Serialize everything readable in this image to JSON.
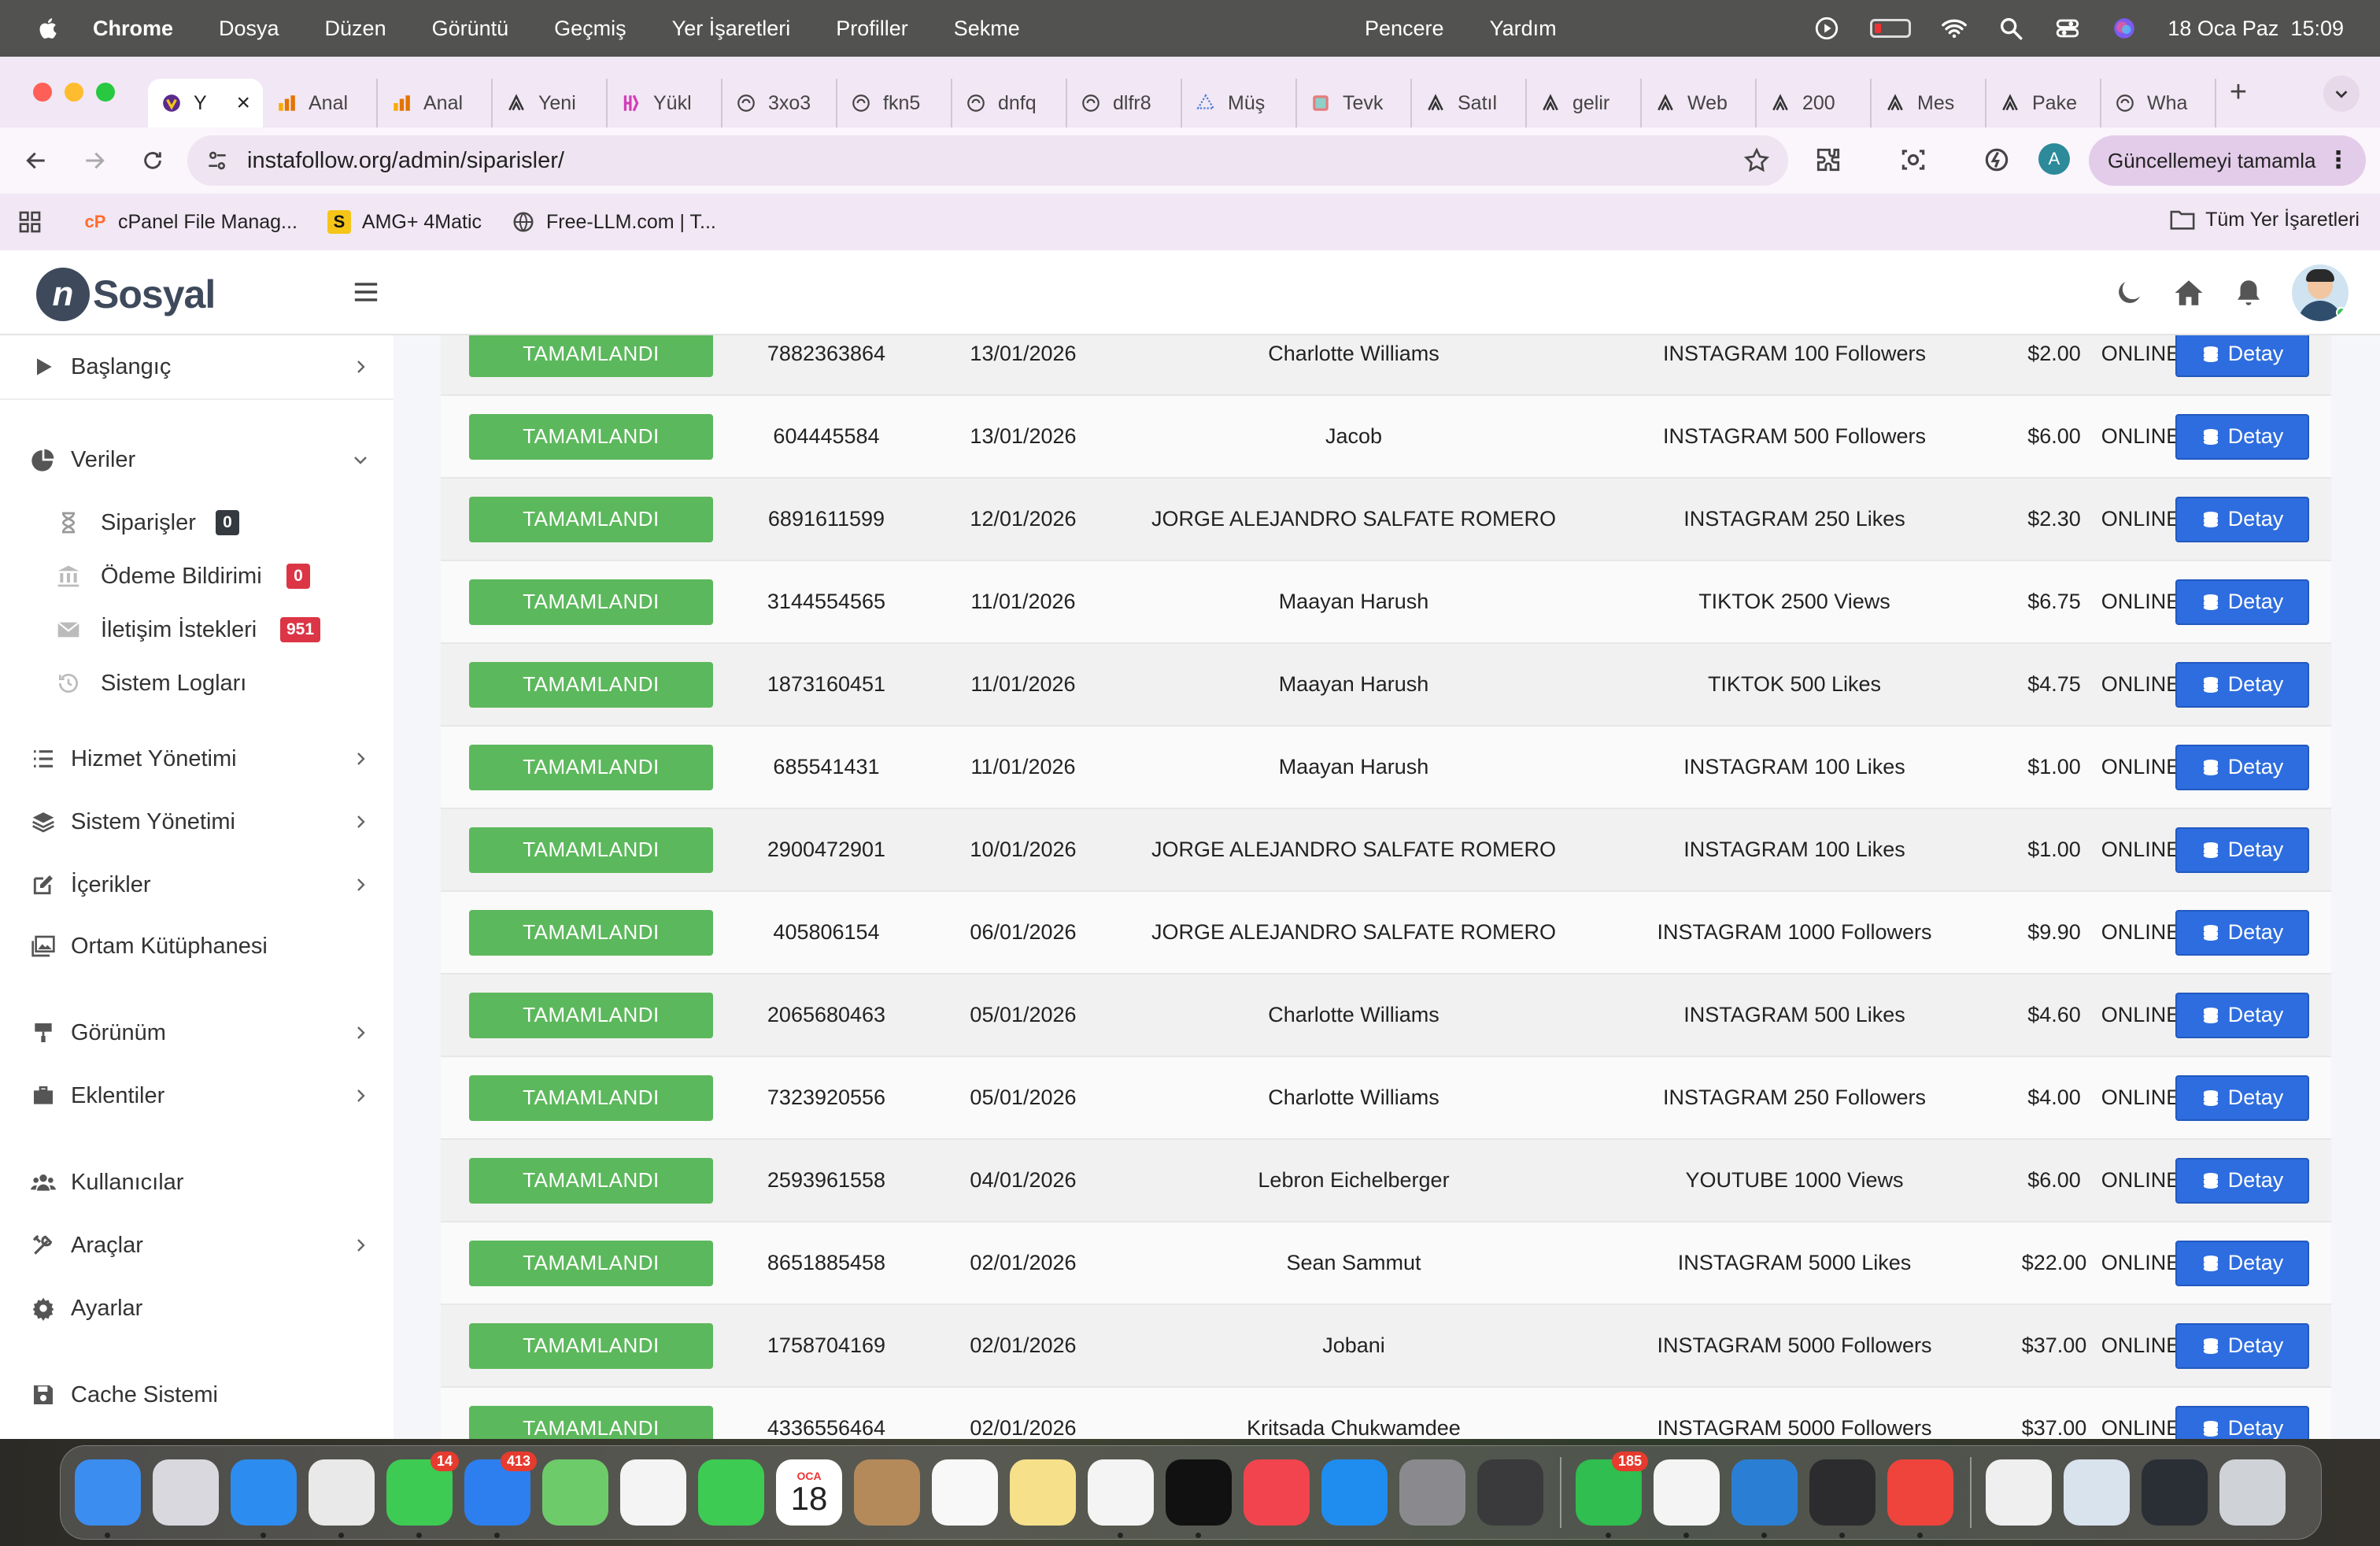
{
  "menubar": {
    "items": [
      "Chrome",
      "Dosya",
      "Düzen",
      "Görüntü",
      "Geçmiş",
      "Yer İşaretleri",
      "Profiller",
      "Sekme"
    ],
    "center_items": [
      "Pencere",
      "Yardım"
    ],
    "datetime": "18 Oca Paz  15:09"
  },
  "browser": {
    "tabs": [
      {
        "label": "Y",
        "icon": "site-favicon-icon"
      },
      {
        "label": "Anal",
        "icon": "analytics-icon"
      },
      {
        "label": "Anal",
        "icon": "analytics-icon"
      },
      {
        "label": "Yeni",
        "icon": "sosyal-icon"
      },
      {
        "label": "Yükl",
        "icon": "yandex-icon"
      },
      {
        "label": "3xo3",
        "icon": "globe-icon"
      },
      {
        "label": "fkn5",
        "icon": "globe-icon"
      },
      {
        "label": "dnfq",
        "icon": "globe-icon"
      },
      {
        "label": "dlfr8",
        "icon": "globe-icon"
      },
      {
        "label": "Müş",
        "icon": "tree-icon"
      },
      {
        "label": "Tevk",
        "icon": "image-icon"
      },
      {
        "label": "Satıl",
        "icon": "sosyal-icon"
      },
      {
        "label": "gelir",
        "icon": "sosyal-icon"
      },
      {
        "label": "Web",
        "icon": "sosyal-icon"
      },
      {
        "label": "200",
        "icon": "sosyal-icon"
      },
      {
        "label": "Mes",
        "icon": "sosyal-icon"
      },
      {
        "label": "Pake",
        "icon": "sosyal-icon"
      },
      {
        "label": "Wha",
        "icon": "globe-icon"
      }
    ],
    "url": "instafollow.org/admin/siparisler/",
    "profile_initial": "A",
    "update_label": "Güncellemeyi tamamla",
    "bookmarks": [
      {
        "label": "cPanel File Manag...",
        "icon": "cpanel-icon"
      },
      {
        "label": "AMG+ 4Matic",
        "icon": "s-icon"
      },
      {
        "label": "Free-LLM.com | T...",
        "icon": "globe-icon"
      }
    ],
    "all_bookmarks": "Tüm Yer İşaretleri"
  },
  "app": {
    "logo_text": "Sosyal",
    "sidebar": {
      "start": "Başlangıç",
      "data_group": "Veriler",
      "orders": "Siparişler",
      "orders_count": "0",
      "payments": "Ödeme Bildirimi",
      "payments_count": "0",
      "contacts": "İletişim İstekleri",
      "contacts_count": "951",
      "logs": "Sistem Logları",
      "service_mgmt": "Hizmet Yönetimi",
      "system_mgmt": "Sistem Yönetimi",
      "contents": "İçerikler",
      "media": "Ortam Kütüphanesi",
      "appearance": "Görünüm",
      "plugins": "Eklentiler",
      "users": "Kullanıcılar",
      "tools": "Araçlar",
      "settings": "Ayarlar",
      "cache": "Cache Sistemi"
    },
    "detail_label": "Detay",
    "orders": [
      {
        "status": "TAMAMLANDI",
        "id": "7882363864",
        "date": "13/01/2026",
        "name": "Charlotte Williams",
        "service": "INSTAGRAM 100 Followers",
        "price": "$2.00",
        "payment": "ONLINE"
      },
      {
        "status": "TAMAMLANDI",
        "id": "604445584",
        "date": "13/01/2026",
        "name": "Jacob",
        "service": "INSTAGRAM 500 Followers",
        "price": "$6.00",
        "payment": "ONLINE"
      },
      {
        "status": "TAMAMLANDI",
        "id": "6891611599",
        "date": "12/01/2026",
        "name": "JORGE ALEJANDRO SALFATE ROMERO",
        "service": "INSTAGRAM 250 Likes",
        "price": "$2.30",
        "payment": "ONLINE"
      },
      {
        "status": "TAMAMLANDI",
        "id": "3144554565",
        "date": "11/01/2026",
        "name": "Maayan Harush",
        "service": "TIKTOK 2500 Views",
        "price": "$6.75",
        "payment": "ONLINE"
      },
      {
        "status": "TAMAMLANDI",
        "id": "1873160451",
        "date": "11/01/2026",
        "name": "Maayan Harush",
        "service": "TIKTOK 500 Likes",
        "price": "$4.75",
        "payment": "ONLINE"
      },
      {
        "status": "TAMAMLANDI",
        "id": "685541431",
        "date": "11/01/2026",
        "name": "Maayan Harush",
        "service": "INSTAGRAM 100 Likes",
        "price": "$1.00",
        "payment": "ONLINE"
      },
      {
        "status": "TAMAMLANDI",
        "id": "2900472901",
        "date": "10/01/2026",
        "name": "JORGE ALEJANDRO SALFATE ROMERO",
        "service": "INSTAGRAM 100 Likes",
        "price": "$1.00",
        "payment": "ONLINE"
      },
      {
        "status": "TAMAMLANDI",
        "id": "405806154",
        "date": "06/01/2026",
        "name": "JORGE ALEJANDRO SALFATE ROMERO",
        "service": "INSTAGRAM 1000 Followers",
        "price": "$9.90",
        "payment": "ONLINE"
      },
      {
        "status": "TAMAMLANDI",
        "id": "2065680463",
        "date": "05/01/2026",
        "name": "Charlotte Williams",
        "service": "INSTAGRAM 500 Likes",
        "price": "$4.60",
        "payment": "ONLINE"
      },
      {
        "status": "TAMAMLANDI",
        "id": "7323920556",
        "date": "05/01/2026",
        "name": "Charlotte Williams",
        "service": "INSTAGRAM 250 Followers",
        "price": "$4.00",
        "payment": "ONLINE"
      },
      {
        "status": "TAMAMLANDI",
        "id": "2593961558",
        "date": "04/01/2026",
        "name": "Lebron Eichelberger",
        "service": "YOUTUBE 1000 Views",
        "price": "$6.00",
        "payment": "ONLINE"
      },
      {
        "status": "TAMAMLANDI",
        "id": "8651885458",
        "date": "02/01/2026",
        "name": "Sean Sammut",
        "service": "INSTAGRAM 5000 Likes",
        "price": "$22.00",
        "payment": "ONLINE"
      },
      {
        "status": "TAMAMLANDI",
        "id": "1758704169",
        "date": "02/01/2026",
        "name": "Jobani",
        "service": "INSTAGRAM 5000 Followers",
        "price": "$37.00",
        "payment": "ONLINE"
      },
      {
        "status": "TAMAMLANDI",
        "id": "4336556464",
        "date": "02/01/2026",
        "name": "Kritsada Chukwamdee",
        "service": "INSTAGRAM 5000 Followers",
        "price": "$37.00",
        "payment": "ONLINE"
      }
    ]
  },
  "dock": {
    "apps": [
      {
        "name": "finder",
        "color": "#3b8df0"
      },
      {
        "name": "launchpad",
        "color": "#d8d8de"
      },
      {
        "name": "safari",
        "color": "#2d8cf0"
      },
      {
        "name": "chrome",
        "color": "#e9e9e9"
      },
      {
        "name": "messages",
        "color": "#3ecb53",
        "badge": "14"
      },
      {
        "name": "mail",
        "color": "#2d7ff0",
        "badge": "413"
      },
      {
        "name": "maps",
        "color": "#6ecb6a"
      },
      {
        "name": "photos",
        "color": "#f4f4f4"
      },
      {
        "name": "facetime",
        "color": "#3ecb53"
      },
      {
        "name": "calendar",
        "color": "#ffffff",
        "month": "OCA",
        "day": "18"
      },
      {
        "name": "contacts",
        "color": "#b58a5a"
      },
      {
        "name": "reminders",
        "color": "#f8f8f8"
      },
      {
        "name": "notes",
        "color": "#f7e08a"
      },
      {
        "name": "freeform",
        "color": "#f4f4f4"
      },
      {
        "name": "tv",
        "color": "#111111"
      },
      {
        "name": "music",
        "color": "#f2444e"
      },
      {
        "name": "app-store",
        "color": "#1f8cf0"
      },
      {
        "name": "system-settings",
        "color": "#8a8a8e"
      },
      {
        "name": "iphone-mirroring",
        "color": "#3a3a3c"
      },
      {
        "name": "whatsapp",
        "color": "#2fbe4f",
        "badge": "185"
      },
      {
        "name": "textedit",
        "color": "#f4f4f4"
      },
      {
        "name": "vscode",
        "color": "#2a7fd4"
      },
      {
        "name": "quicktime",
        "color": "#2c2c2e"
      },
      {
        "name": "anydesk",
        "color": "#ef443b"
      },
      {
        "name": "document",
        "color": "#efefef"
      },
      {
        "name": "screenshot-1",
        "color": "#d9e3ee"
      },
      {
        "name": "screenshot-2",
        "color": "#2a2f36"
      },
      {
        "name": "trash",
        "color": "#cfd3d8"
      }
    ]
  }
}
